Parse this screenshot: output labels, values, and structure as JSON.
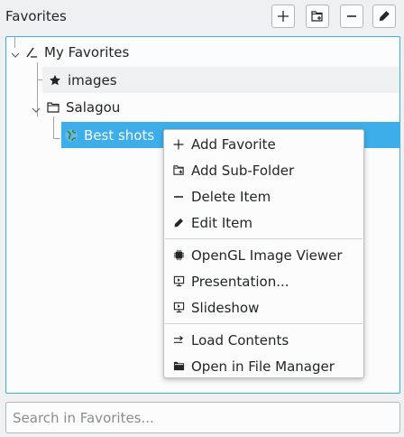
{
  "header": {
    "title": "Favorites",
    "buttons": [
      {
        "icon": "plus-icon",
        "label": "Add Favorite"
      },
      {
        "icon": "add-folder-icon",
        "label": "Add Sub-Folder"
      },
      {
        "icon": "minus-icon",
        "label": "Delete Item"
      },
      {
        "icon": "pencil-icon",
        "label": "Edit Item"
      }
    ]
  },
  "tree": {
    "items": [
      {
        "label": "My Favorites",
        "icon": "root-icon",
        "expanded": true
      },
      {
        "label": "images",
        "icon": "star-icon"
      },
      {
        "label": "Salagou",
        "icon": "folder-icon",
        "expanded": true
      },
      {
        "label": "Best shots",
        "icon": "globe-icon",
        "selected": true
      }
    ]
  },
  "context_menu": {
    "items": [
      {
        "label": "Add Favorite",
        "icon": "plus-icon"
      },
      {
        "label": "Add Sub-Folder",
        "icon": "add-folder-icon"
      },
      {
        "label": "Delete Item",
        "icon": "minus-icon"
      },
      {
        "label": "Edit Item",
        "icon": "pencil-icon"
      },
      {
        "label": "OpenGL Image Viewer",
        "icon": "chip-icon"
      },
      {
        "label": "Presentation...",
        "icon": "presentation-icon"
      },
      {
        "label": "Slideshow",
        "icon": "slideshow-icon"
      },
      {
        "label": "Load Contents",
        "icon": "load-contents-icon"
      },
      {
        "label": "Open in File Manager",
        "icon": "file-manager-icon"
      }
    ]
  },
  "search": {
    "placeholder": "Search in Favorites...",
    "value": ""
  },
  "colors": {
    "accent": "#3daee9",
    "background": "#eff0f1",
    "text": "#232627"
  }
}
